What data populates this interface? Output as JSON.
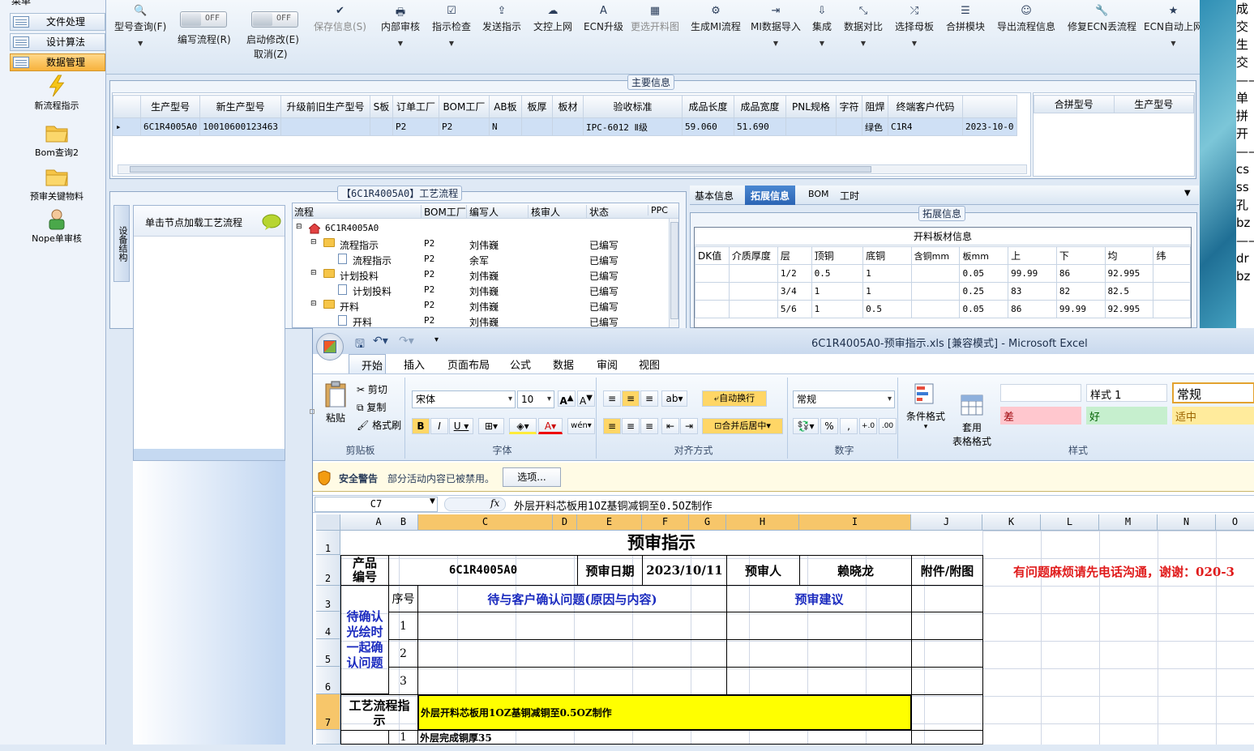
{
  "left_nav": {
    "tabs": [
      {
        "label": "文件处理"
      },
      {
        "label": "设计算法"
      },
      {
        "label": "数据管理"
      }
    ],
    "items": [
      {
        "label": "新流程指示",
        "icon": "lightning-icon"
      },
      {
        "label": "Bom查询2",
        "icon": "folder-icon"
      },
      {
        "label": "预审关键物料",
        "icon": "folder-icon"
      },
      {
        "label": "Nope单审核",
        "icon": "user-icon"
      }
    ]
  },
  "toolbar": {
    "items": [
      {
        "label": "型号查询(F)",
        "glyph": "🔍"
      },
      {
        "label": "编写流程(R)",
        "toggle": "OFF"
      },
      {
        "label": "启动修改(E)",
        "sub": "取消(Z)",
        "toggle": "OFF"
      },
      {
        "label": "保存信息(S)",
        "glyph": "✔"
      },
      {
        "label": "内部审核",
        "glyph": "🖶"
      },
      {
        "label": "指示检查",
        "glyph": "☑"
      },
      {
        "label": "发送指示",
        "glyph": "⇪"
      },
      {
        "label": "文控上网",
        "glyph": "☁"
      },
      {
        "label": "ECN升级",
        "glyph": "A"
      },
      {
        "label": "更选开料图",
        "glyph": "▦"
      },
      {
        "label": "生成MI流程",
        "glyph": "⚙"
      },
      {
        "label": "MI数据导入",
        "glyph": "⇥"
      },
      {
        "label": "集成",
        "glyph": "⇩"
      },
      {
        "label": "数据对比",
        "glyph": "⤡"
      },
      {
        "label": "选择母板",
        "glyph": "⤮"
      },
      {
        "label": "合拼模块",
        "glyph": "☰"
      },
      {
        "label": "导出流程信息",
        "glyph": "☺"
      },
      {
        "label": "修复ECN丢流程",
        "glyph": "🔧"
      },
      {
        "label": "ECN自动上网",
        "glyph": "★"
      }
    ]
  },
  "main_info": {
    "title": "主要信息",
    "columns": [
      "生产型号",
      "新生产型号",
      "升级前旧生产型号",
      "S板",
      "订单工厂",
      "BOM工厂",
      "AB板",
      "板厚",
      "板材",
      "验收标准",
      "成品长度",
      "成品宽度",
      "PNL规格",
      "字符",
      "阻焊",
      "终端客户代码"
    ],
    "row": [
      "6C1R4005A0",
      "10010600123463",
      "",
      "",
      "P2",
      "P2",
      "N",
      "",
      "",
      "IPC-6012 Ⅱ级",
      "59.060",
      "51.690",
      "",
      "",
      "绿色",
      "C1R4",
      "2023-10-0"
    ],
    "side_columns": [
      "合拼型号",
      "生产型号"
    ]
  },
  "process": {
    "title": "【6C1R4005A0】工艺流程",
    "vtab": "设备结构",
    "hint": "单击节点加载工艺流程",
    "columns": [
      "流程",
      "BOM工厂",
      "编写人",
      "核审人",
      "状态",
      "PPC"
    ],
    "root": "6C1R4005A0",
    "rows": [
      {
        "name": "流程指示",
        "bom": "P2",
        "writer": "刘伟巍",
        "status": "已编写",
        "level": 1,
        "type": "folder"
      },
      {
        "name": "流程指示",
        "bom": "P2",
        "writer": "余军",
        "status": "已编写",
        "level": 2,
        "type": "doc"
      },
      {
        "name": "计划投料",
        "bom": "P2",
        "writer": "刘伟巍",
        "status": "已编写",
        "level": 1,
        "type": "folder"
      },
      {
        "name": "计划投料",
        "bom": "P2",
        "writer": "刘伟巍",
        "status": "已编写",
        "level": 2,
        "type": "doc"
      },
      {
        "name": "开料",
        "bom": "P2",
        "writer": "刘伟巍",
        "status": "已编写",
        "level": 1,
        "type": "folder"
      },
      {
        "name": "开料",
        "bom": "P2",
        "writer": "刘伟巍",
        "status": "已编写",
        "level": 2,
        "type": "doc"
      }
    ]
  },
  "details": {
    "tabs": [
      "基本信息",
      "拓展信息",
      "BOM",
      "工时"
    ],
    "active_tab": "拓展信息",
    "group_title": "拓展信息",
    "table_title": "开料板材信息",
    "columns": [
      "DK值",
      "介质厚度",
      "层",
      "顶铜",
      "底铜",
      "含铜mm",
      "板mm",
      "上",
      "下",
      "均",
      "纬"
    ],
    "rows": [
      [
        "",
        "",
        "1/2",
        "0.5",
        "1",
        "",
        "0.05",
        "99.99",
        "86",
        "92.995",
        ""
      ],
      [
        "",
        "",
        "3/4",
        "1",
        "1",
        "",
        "0.25",
        "83",
        "82",
        "82.5",
        ""
      ],
      [
        "",
        "",
        "5/6",
        "1",
        "0.5",
        "",
        "0.05",
        "86",
        "99.99",
        "92.995",
        ""
      ]
    ]
  },
  "right_panel": {
    "lines": [
      "成",
      "交",
      "生",
      "交",
      "——",
      "单",
      "拼",
      "开",
      "——",
      "cs",
      "ss",
      "孔",
      "bz",
      "",
      "——",
      "dr",
      "bz",
      "",
      "——"
    ]
  },
  "excel": {
    "title": "6C1R4005A0-预审指示.xls  [兼容模式] - Microsoft Excel",
    "tabs": [
      "开始",
      "插入",
      "页面布局",
      "公式",
      "数据",
      "审阅",
      "视图"
    ],
    "active_tab": "开始",
    "clipboard": {
      "paste": "粘贴",
      "cut": "剪切",
      "copy": "复制",
      "format_painter": "格式刷",
      "label": "剪贴板"
    },
    "font": {
      "name": "宋体",
      "size": "10",
      "label": "字体"
    },
    "align": {
      "wrap": "自动换行",
      "merge": "合并后居中",
      "label": "对齐方式"
    },
    "number": {
      "format": "常规",
      "label": "数字"
    },
    "styles": {
      "cond": "条件格式",
      "table": "套用\n表格格式",
      "style1": "样式 1",
      "normal": "常规",
      "bad": "差",
      "good": "好",
      "neutral": "适中",
      "label": "样式"
    },
    "security": {
      "label": "安全警告",
      "text": "部分活动内容已被禁用。",
      "button": "选项..."
    },
    "name_box": "C7",
    "formula": "外层开料芯板用1OZ基铜减铜至0.5OZ制作",
    "col_headers": [
      "A",
      "B",
      "C",
      "D",
      "E",
      "F",
      "G",
      "H",
      "I",
      "J",
      "K",
      "L",
      "M",
      "N",
      "O"
    ],
    "row_headers": [
      "1",
      "2",
      "3",
      "4",
      "5",
      "6",
      "7"
    ],
    "sheet": {
      "title": "预审指示",
      "product_no_label": "产品\n编号",
      "product_no": "6C1R4005A0",
      "date_label": "预审日期",
      "date": "2023/10/11",
      "reviewer_label": "预审人",
      "reviewer": "赖晓龙",
      "attachment_label": "附件/附图",
      "notice": "有问题麻烦请先电话沟通，谢谢：020-3",
      "pending_label": "待确认光绘时一起确认问题",
      "seq_label": "序号",
      "issue_header": "待与客户确认问题(原因与内容)",
      "suggest_header": "预审建议",
      "seq": [
        "1",
        "2",
        "3"
      ],
      "process_label": "工艺流程指示",
      "process_text": "外层开料芯板用1OZ基铜减铜至0.5OZ制作",
      "next_row_seq": "1",
      "next_row_text": "外层完成铜厚35"
    }
  }
}
